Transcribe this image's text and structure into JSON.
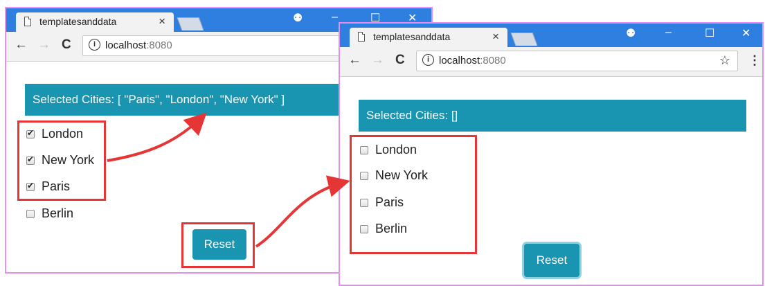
{
  "left_window": {
    "tab_title": "templatesanddata",
    "tab_close": "×",
    "nav": {
      "back": "←",
      "forward": "→",
      "reload": "C"
    },
    "address": {
      "host": "localhost",
      "port": ":8080",
      "info": "i"
    },
    "header": "Selected Cities: [ \"Paris\", \"London\", \"New York\" ]",
    "cities": [
      {
        "label": "London",
        "checked": true
      },
      {
        "label": "New York",
        "checked": true
      },
      {
        "label": "Paris",
        "checked": true
      },
      {
        "label": "Berlin",
        "checked": false
      }
    ],
    "reset_label": "Reset"
  },
  "right_window": {
    "tab_title": "templatesanddata",
    "tab_close": "×",
    "nav": {
      "back": "←",
      "forward": "→",
      "reload": "C"
    },
    "address": {
      "host": "localhost",
      "port": ":8080",
      "info": "i"
    },
    "star": "☆",
    "menu": "⋮",
    "header": "Selected Cities: []",
    "cities": [
      {
        "label": "London",
        "checked": false
      },
      {
        "label": "New York",
        "checked": false
      },
      {
        "label": "Paris",
        "checked": false
      },
      {
        "label": "Berlin",
        "checked": false
      }
    ],
    "reset_label": "Reset"
  },
  "window_controls": {
    "profile": "⚉",
    "minimize": "–",
    "maximize": "☐",
    "close": "✕"
  },
  "colors": {
    "chrome_blue": "#2f7fe0",
    "teal": "#1a95b1",
    "highlight_red": "#e53535",
    "window_border": "#e58ef2"
  }
}
